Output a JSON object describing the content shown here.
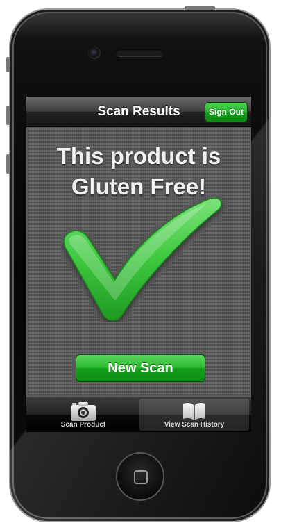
{
  "navbar": {
    "title": "Scan Results",
    "sign_out_label": "Sign Out"
  },
  "result": {
    "line1": "This product is",
    "line2": "Gluten Free!",
    "icon": "green-checkmark"
  },
  "actions": {
    "new_scan_label": "New Scan"
  },
  "tabbar": {
    "items": [
      {
        "label": "Scan Product",
        "icon": "camera-icon",
        "selected": false
      },
      {
        "label": "View Scan History",
        "icon": "book-icon",
        "selected": true
      }
    ]
  },
  "colors": {
    "accent_green": "#27b22d",
    "checkmark_green": "#3ec83f",
    "background_gray": "#595959"
  }
}
